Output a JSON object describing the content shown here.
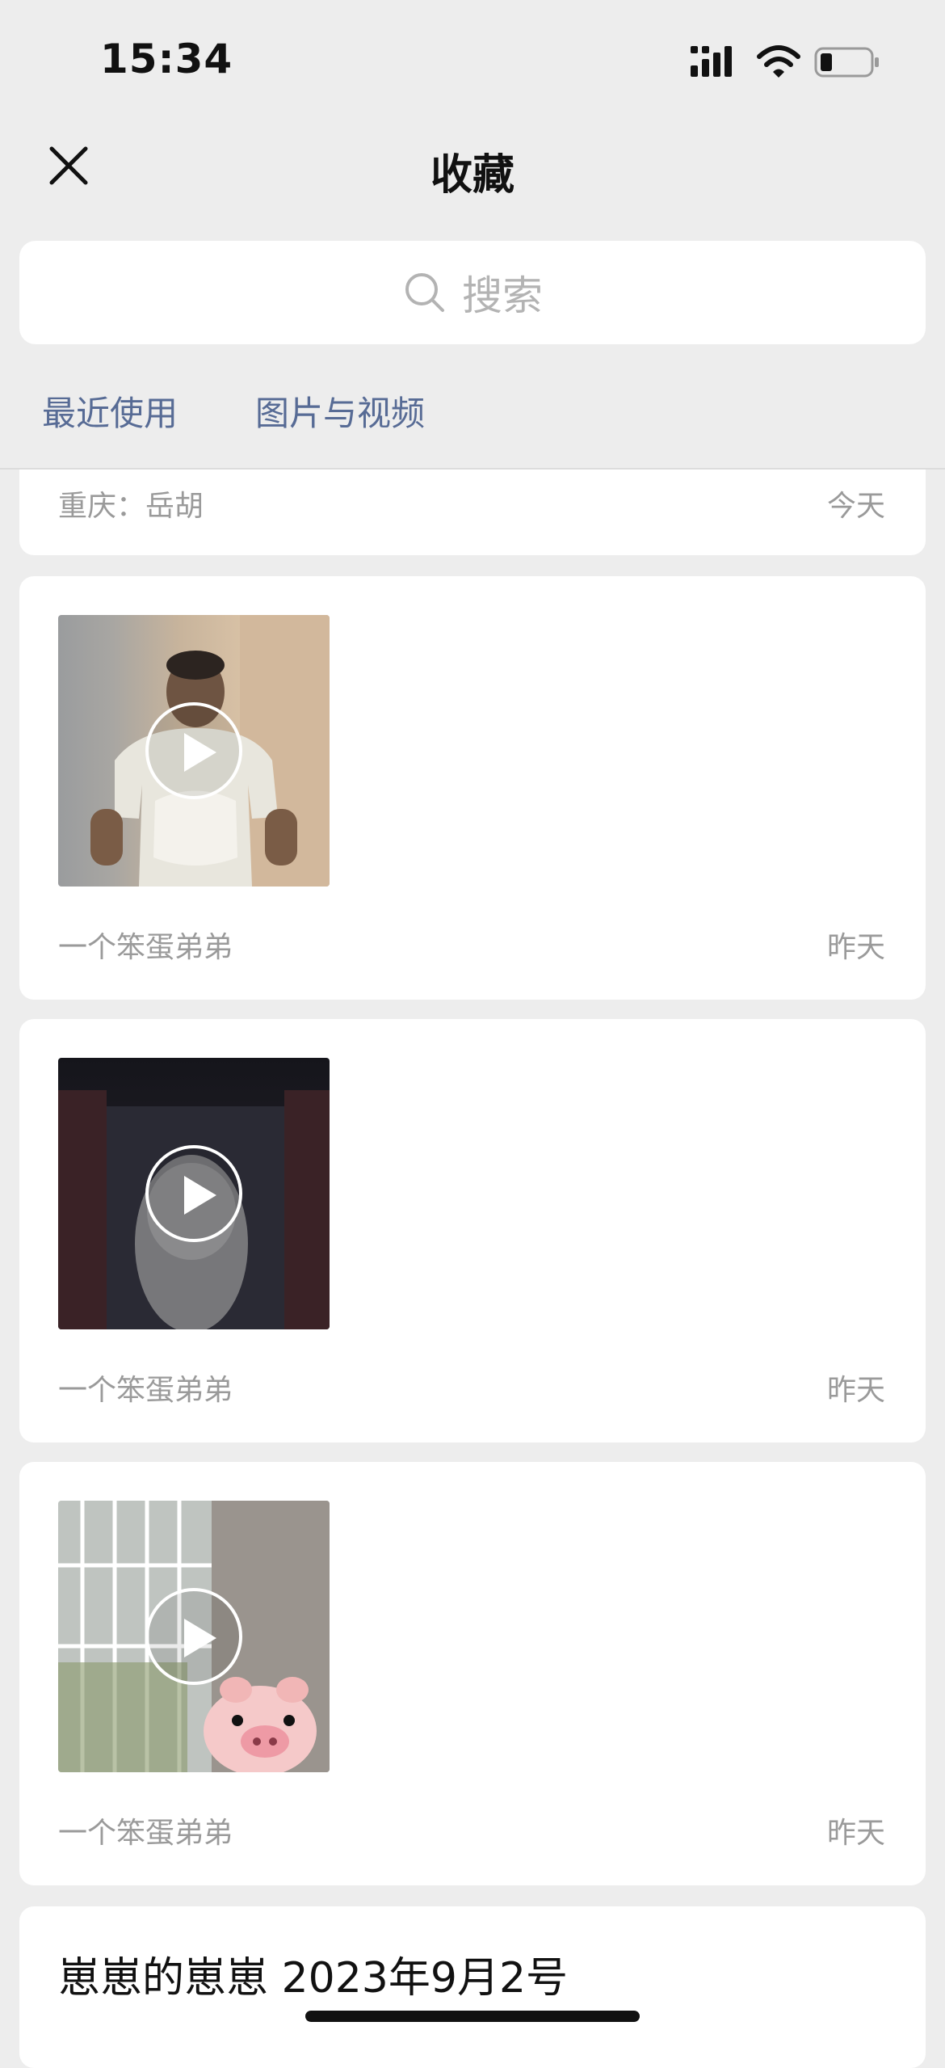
{
  "status_bar": {
    "time": "15:34"
  },
  "nav": {
    "title": "收藏"
  },
  "search": {
    "placeholder": "搜索"
  },
  "tabs": [
    {
      "label": "最近使用"
    },
    {
      "label": "图片与视频"
    }
  ],
  "items": [
    {
      "type": "text",
      "source": "重庆：岳胡",
      "date": "今天"
    },
    {
      "type": "video",
      "source": "一个笨蛋弟弟",
      "date": "昨天"
    },
    {
      "type": "video",
      "source": "一个笨蛋弟弟",
      "date": "昨天"
    },
    {
      "type": "video",
      "source": "一个笨蛋弟弟",
      "date": "昨天"
    },
    {
      "type": "note",
      "title": "崽崽的崽崽 2023年9月2号"
    }
  ],
  "colors": {
    "background": "#ededed",
    "link_blue": "#576b95",
    "meta_gray": "#9a9a9a"
  },
  "icons": [
    "close-icon",
    "search-icon",
    "play-icon",
    "signal-icon",
    "wifi-icon",
    "battery-icon"
  ]
}
